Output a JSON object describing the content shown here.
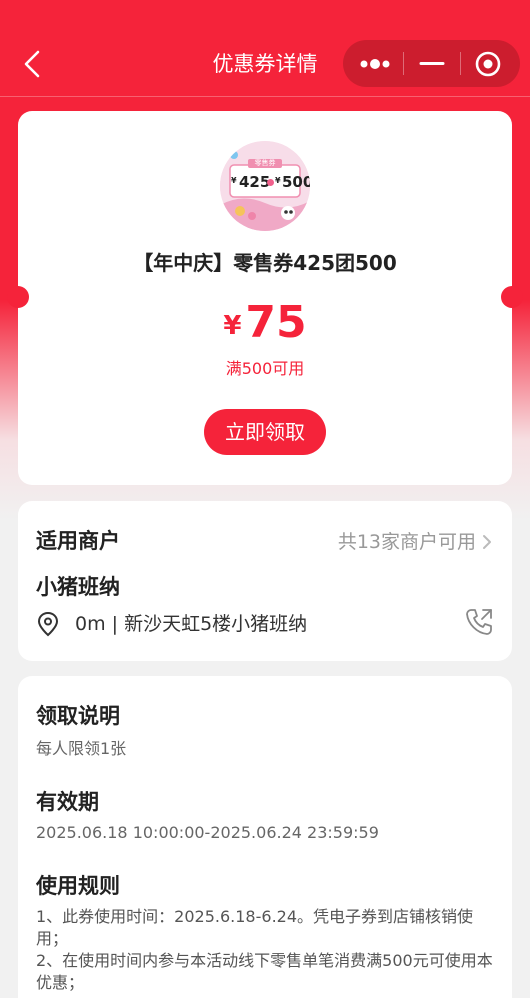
{
  "nav": {
    "title": "优惠券详情"
  },
  "coupon": {
    "image": {
      "tag": "零售券",
      "from": "425",
      "to": "500",
      "yen": "¥"
    },
    "name": "【年中庆】零售券425团500",
    "currency": "¥",
    "price": "75",
    "condition": "满500可用",
    "claim_label": "立即领取"
  },
  "merchant": {
    "title": "适用商户",
    "count_label": "共13家商户可用",
    "name": "小猪班纳",
    "location": "0m | 新沙天虹5楼小猪班纳"
  },
  "info": {
    "claim_title": "领取说明",
    "claim_text": "每人限领1张",
    "validity_title": "有效期",
    "validity_text": "2025.06.18 10:00:00-2025.06.24 23:59:59",
    "rules_title": "使用规则",
    "rules": [
      "1、此券使用时间：2025.6.18-6.24。凭电子券到店铺核销使用；",
      "2、在使用时间内参与本活动线下零售单笔消费满500元可使用本优惠；"
    ]
  },
  "colors": {
    "brand": "#f5233a",
    "capsule": "#cc1d2e"
  },
  "icons": [
    "back-arrow-icon",
    "more-dots-icon",
    "minimize-icon",
    "close-target-icon",
    "chevron-right-icon",
    "location-pin-icon",
    "phone-icon"
  ]
}
